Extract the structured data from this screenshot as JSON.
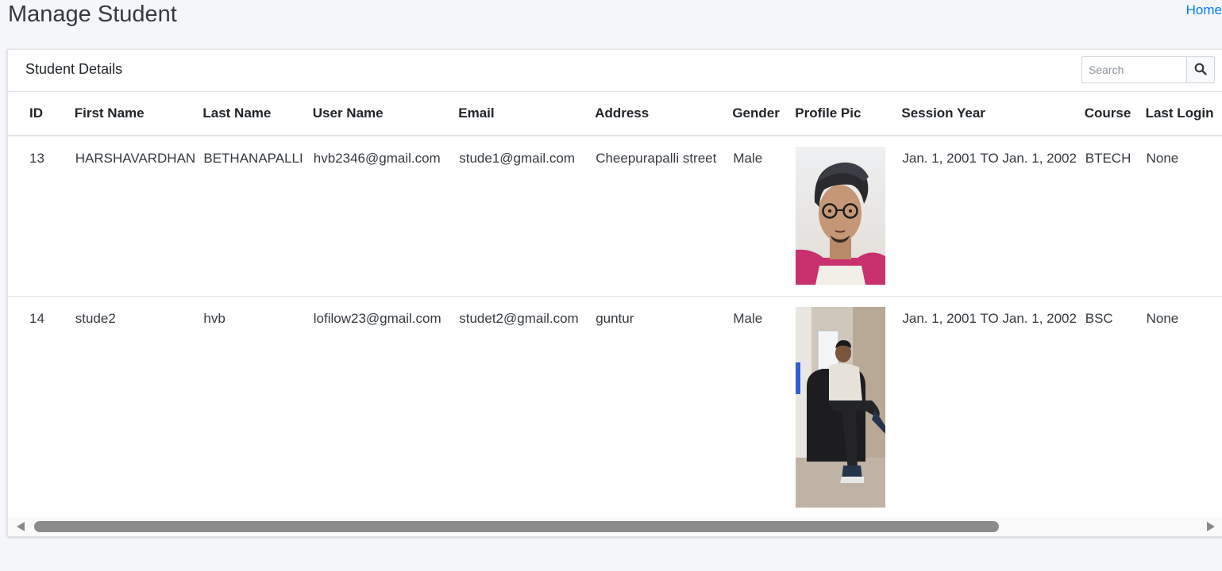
{
  "page": {
    "title": "Manage Student",
    "breadcrumb_home": "Home"
  },
  "card": {
    "title": "Student Details",
    "search_placeholder": "Search",
    "search_icon": "search-icon"
  },
  "table": {
    "headers": {
      "id": "ID",
      "first_name": "First Name",
      "last_name": "Last Name",
      "user_name": "User Name",
      "email": "Email",
      "address": "Address",
      "gender": "Gender",
      "profile_pic": "Profile Pic",
      "session_year": "Session Year",
      "course": "Course",
      "last_login": "Last Login"
    },
    "rows": [
      {
        "id": "13",
        "first_name": "HARSHAVARDHAN",
        "last_name": "BETHANAPALLI",
        "user_name": "hvb2346@gmail.com",
        "email": "stude1@gmail.com",
        "address": "Cheepurapalli street",
        "gender": "Male",
        "session_year": "Jan. 1, 2001 TO Jan. 1, 2002",
        "course": "BTECH",
        "last_login": "None"
      },
      {
        "id": "14",
        "first_name": "stude2",
        "last_name": "hvb",
        "user_name": "lofilow23@gmail.com",
        "email": "studet2@gmail.com",
        "address": "guntur",
        "gender": "Male",
        "session_year": "Jan. 1, 2001 TO Jan. 1, 2002",
        "course": "BSC",
        "last_login": "None"
      }
    ]
  },
  "colors": {
    "link": "#007bff",
    "background": "#f4f6f9",
    "scroll_thumb": "#8c8c8c"
  }
}
